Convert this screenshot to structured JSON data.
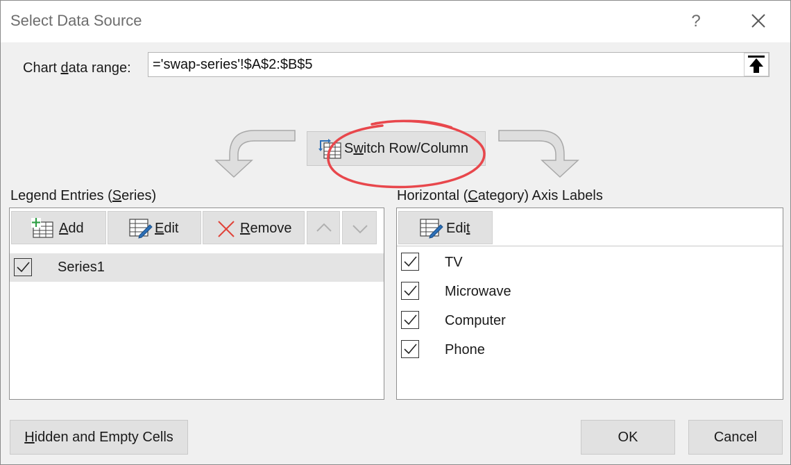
{
  "window": {
    "title": "Select Data Source",
    "help_label": "?"
  },
  "range": {
    "label_pre": "Chart ",
    "label_key": "d",
    "label_post": "ata range:",
    "value": "='swap-series'!$A$2:$B$5"
  },
  "switch_button": {
    "label_pre": "S",
    "label_key": "w",
    "label_post": "itch Row/Column"
  },
  "legend": {
    "label_pre": "Legend Entries (",
    "label_key": "S",
    "label_post": "eries)",
    "add": {
      "key": "A",
      "rest": "dd"
    },
    "edit": {
      "key": "E",
      "rest": "dit"
    },
    "remove": {
      "key": "R",
      "rest": "emove"
    },
    "series": [
      {
        "label": "Series1",
        "checked": true
      }
    ]
  },
  "axis": {
    "label_pre": "Horizontal (",
    "label_key": "C",
    "label_post": "ategory) Axis Labels",
    "edit": {
      "pre": "Edi",
      "key": "t"
    },
    "categories": [
      {
        "label": "TV",
        "checked": true
      },
      {
        "label": "Microwave",
        "checked": true
      },
      {
        "label": "Computer",
        "checked": true
      },
      {
        "label": "Phone",
        "checked": true
      }
    ]
  },
  "footer": {
    "hidden": {
      "key": "H",
      "rest": "idden and Empty Cells"
    },
    "ok": "OK",
    "cancel": "Cancel"
  },
  "colors": {
    "highlight_circle": "#e8474c",
    "remove_icon": "#e0433a",
    "add_plus": "#2e9e44",
    "edit_pencil": "#2c6fb7"
  }
}
